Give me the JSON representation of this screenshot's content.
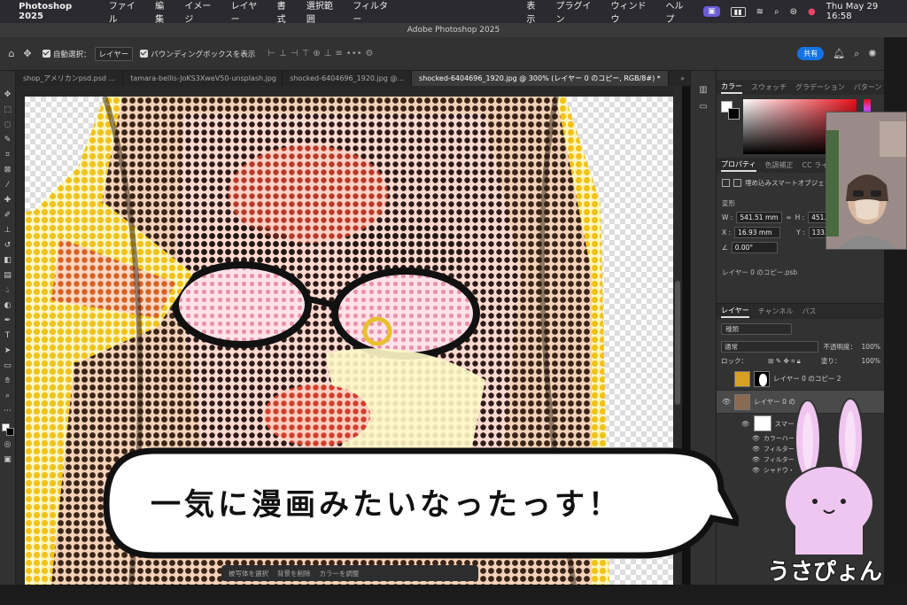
{
  "menubar": {
    "app_name": "Photoshop 2025",
    "items": [
      "ファイル",
      "編集",
      "イメージ",
      "レイヤー",
      "書式",
      "選択範囲",
      "フィルター",
      "表示",
      "プラグイン",
      "ウィンドウ",
      "ヘルプ"
    ],
    "clock": "Thu May 29  16:58"
  },
  "window": {
    "title": "Adobe Photoshop 2025"
  },
  "options": {
    "auto_select_label": "自動選択：",
    "auto_select_value": "レイヤー",
    "bbox_label": "バウンディングボックスを表示",
    "share_label": "共有"
  },
  "tabs": [
    {
      "label": "shop_アメリカンpsd.psd ..."
    },
    {
      "label": "tamara-bellis-JoKS3XweV50-unsplash.jpg"
    },
    {
      "label": "shocked-6404696_1920.jpg @..."
    },
    {
      "label": "shocked-6404696_1920.jpg @ 300% (レイヤー 0 のコピー, RGB/8#) *"
    }
  ],
  "color_panel": {
    "tabs": [
      "カラー",
      "スウォッチ",
      "グラデーション",
      "パターン"
    ]
  },
  "properties": {
    "tabs": [
      "プロパティ",
      "色調補正",
      "CC ライ"
    ],
    "kind_label": "埋め込みスマートオブジェクト",
    "section_transform": "変形",
    "w_label": "W :",
    "w_value": "541.51 mm",
    "h_label": "H :",
    "h_value": "451.91 mm",
    "x_label": "X :",
    "x_value": "16.93 mm",
    "y_label": "Y :",
    "y_value": "133.35 m",
    "angle_value": "0.00°",
    "file_name": "レイヤー 0 のコピー.psb"
  },
  "layers": {
    "tabs": [
      "レイヤー",
      "チャンネル",
      "パス"
    ],
    "search_placeholder": "種類",
    "blend_mode": "通常",
    "opacity_label": "不透明度：",
    "opacity_value": "100%",
    "lock_label": "ロック：",
    "fill_label": "塗り：",
    "fill_value": "100%",
    "items": [
      {
        "name": "レイヤー 0 のコピー 2"
      },
      {
        "name": "レイヤー 0 の"
      }
    ],
    "smart_filter_label": "スマー",
    "filters": [
      "カラーハー",
      "フィルター",
      "フィルター",
      "シャドウ・"
    ]
  },
  "ctxbar": {
    "items": [
      "被写体を選択",
      "背景を削除",
      "カラーを調整"
    ]
  },
  "overlay": {
    "bubble_text": "一気に漫画みたいなったっす！",
    "character_name": "うさぴょん"
  },
  "colors": {
    "accent": "#1473e6",
    "halftone_yellow": "#f2c21a",
    "bubble_fill": "#ffffff",
    "usagi_pink": "#efc6ef"
  }
}
